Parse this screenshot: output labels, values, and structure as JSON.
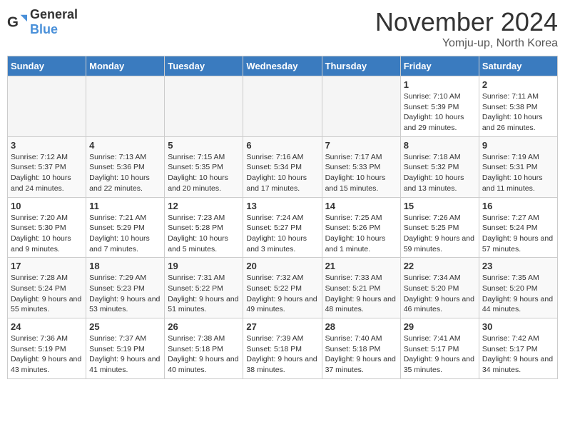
{
  "header": {
    "logo_general": "General",
    "logo_blue": "Blue",
    "month_title": "November 2024",
    "location": "Yomju-up, North Korea"
  },
  "days_of_week": [
    "Sunday",
    "Monday",
    "Tuesday",
    "Wednesday",
    "Thursday",
    "Friday",
    "Saturday"
  ],
  "weeks": [
    [
      {
        "day": "",
        "empty": true
      },
      {
        "day": "",
        "empty": true
      },
      {
        "day": "",
        "empty": true
      },
      {
        "day": "",
        "empty": true
      },
      {
        "day": "",
        "empty": true
      },
      {
        "day": "1",
        "sunrise": "Sunrise: 7:10 AM",
        "sunset": "Sunset: 5:39 PM",
        "daylight": "Daylight: 10 hours and 29 minutes."
      },
      {
        "day": "2",
        "sunrise": "Sunrise: 7:11 AM",
        "sunset": "Sunset: 5:38 PM",
        "daylight": "Daylight: 10 hours and 26 minutes."
      }
    ],
    [
      {
        "day": "3",
        "sunrise": "Sunrise: 7:12 AM",
        "sunset": "Sunset: 5:37 PM",
        "daylight": "Daylight: 10 hours and 24 minutes."
      },
      {
        "day": "4",
        "sunrise": "Sunrise: 7:13 AM",
        "sunset": "Sunset: 5:36 PM",
        "daylight": "Daylight: 10 hours and 22 minutes."
      },
      {
        "day": "5",
        "sunrise": "Sunrise: 7:15 AM",
        "sunset": "Sunset: 5:35 PM",
        "daylight": "Daylight: 10 hours and 20 minutes."
      },
      {
        "day": "6",
        "sunrise": "Sunrise: 7:16 AM",
        "sunset": "Sunset: 5:34 PM",
        "daylight": "Daylight: 10 hours and 17 minutes."
      },
      {
        "day": "7",
        "sunrise": "Sunrise: 7:17 AM",
        "sunset": "Sunset: 5:33 PM",
        "daylight": "Daylight: 10 hours and 15 minutes."
      },
      {
        "day": "8",
        "sunrise": "Sunrise: 7:18 AM",
        "sunset": "Sunset: 5:32 PM",
        "daylight": "Daylight: 10 hours and 13 minutes."
      },
      {
        "day": "9",
        "sunrise": "Sunrise: 7:19 AM",
        "sunset": "Sunset: 5:31 PM",
        "daylight": "Daylight: 10 hours and 11 minutes."
      }
    ],
    [
      {
        "day": "10",
        "sunrise": "Sunrise: 7:20 AM",
        "sunset": "Sunset: 5:30 PM",
        "daylight": "Daylight: 10 hours and 9 minutes."
      },
      {
        "day": "11",
        "sunrise": "Sunrise: 7:21 AM",
        "sunset": "Sunset: 5:29 PM",
        "daylight": "Daylight: 10 hours and 7 minutes."
      },
      {
        "day": "12",
        "sunrise": "Sunrise: 7:23 AM",
        "sunset": "Sunset: 5:28 PM",
        "daylight": "Daylight: 10 hours and 5 minutes."
      },
      {
        "day": "13",
        "sunrise": "Sunrise: 7:24 AM",
        "sunset": "Sunset: 5:27 PM",
        "daylight": "Daylight: 10 hours and 3 minutes."
      },
      {
        "day": "14",
        "sunrise": "Sunrise: 7:25 AM",
        "sunset": "Sunset: 5:26 PM",
        "daylight": "Daylight: 10 hours and 1 minute."
      },
      {
        "day": "15",
        "sunrise": "Sunrise: 7:26 AM",
        "sunset": "Sunset: 5:25 PM",
        "daylight": "Daylight: 9 hours and 59 minutes."
      },
      {
        "day": "16",
        "sunrise": "Sunrise: 7:27 AM",
        "sunset": "Sunset: 5:24 PM",
        "daylight": "Daylight: 9 hours and 57 minutes."
      }
    ],
    [
      {
        "day": "17",
        "sunrise": "Sunrise: 7:28 AM",
        "sunset": "Sunset: 5:24 PM",
        "daylight": "Daylight: 9 hours and 55 minutes."
      },
      {
        "day": "18",
        "sunrise": "Sunrise: 7:29 AM",
        "sunset": "Sunset: 5:23 PM",
        "daylight": "Daylight: 9 hours and 53 minutes."
      },
      {
        "day": "19",
        "sunrise": "Sunrise: 7:31 AM",
        "sunset": "Sunset: 5:22 PM",
        "daylight": "Daylight: 9 hours and 51 minutes."
      },
      {
        "day": "20",
        "sunrise": "Sunrise: 7:32 AM",
        "sunset": "Sunset: 5:22 PM",
        "daylight": "Daylight: 9 hours and 49 minutes."
      },
      {
        "day": "21",
        "sunrise": "Sunrise: 7:33 AM",
        "sunset": "Sunset: 5:21 PM",
        "daylight": "Daylight: 9 hours and 48 minutes."
      },
      {
        "day": "22",
        "sunrise": "Sunrise: 7:34 AM",
        "sunset": "Sunset: 5:20 PM",
        "daylight": "Daylight: 9 hours and 46 minutes."
      },
      {
        "day": "23",
        "sunrise": "Sunrise: 7:35 AM",
        "sunset": "Sunset: 5:20 PM",
        "daylight": "Daylight: 9 hours and 44 minutes."
      }
    ],
    [
      {
        "day": "24",
        "sunrise": "Sunrise: 7:36 AM",
        "sunset": "Sunset: 5:19 PM",
        "daylight": "Daylight: 9 hours and 43 minutes."
      },
      {
        "day": "25",
        "sunrise": "Sunrise: 7:37 AM",
        "sunset": "Sunset: 5:19 PM",
        "daylight": "Daylight: 9 hours and 41 minutes."
      },
      {
        "day": "26",
        "sunrise": "Sunrise: 7:38 AM",
        "sunset": "Sunset: 5:18 PM",
        "daylight": "Daylight: 9 hours and 40 minutes."
      },
      {
        "day": "27",
        "sunrise": "Sunrise: 7:39 AM",
        "sunset": "Sunset: 5:18 PM",
        "daylight": "Daylight: 9 hours and 38 minutes."
      },
      {
        "day": "28",
        "sunrise": "Sunrise: 7:40 AM",
        "sunset": "Sunset: 5:18 PM",
        "daylight": "Daylight: 9 hours and 37 minutes."
      },
      {
        "day": "29",
        "sunrise": "Sunrise: 7:41 AM",
        "sunset": "Sunset: 5:17 PM",
        "daylight": "Daylight: 9 hours and 35 minutes."
      },
      {
        "day": "30",
        "sunrise": "Sunrise: 7:42 AM",
        "sunset": "Sunset: 5:17 PM",
        "daylight": "Daylight: 9 hours and 34 minutes."
      }
    ]
  ]
}
